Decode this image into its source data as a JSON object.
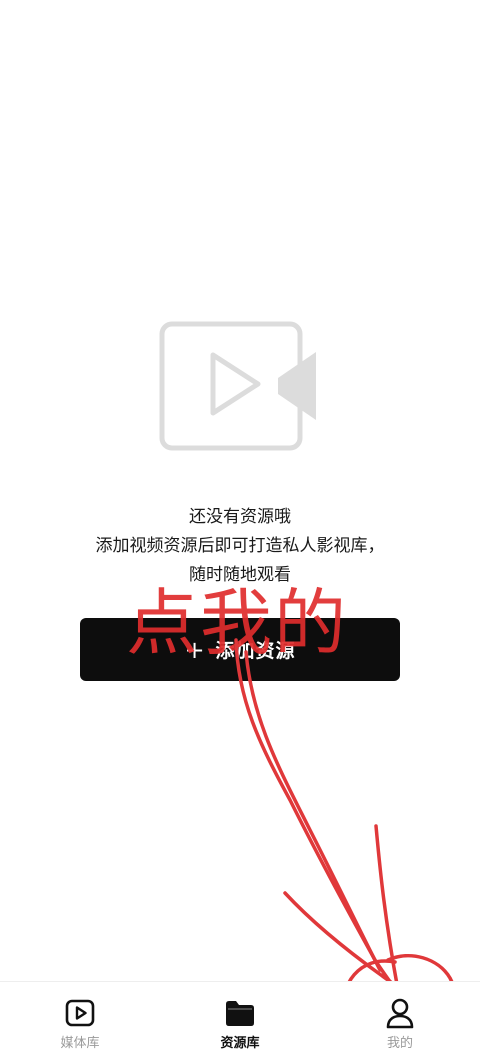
{
  "empty_state": {
    "title": "还没有资源哦",
    "description_line1": "添加视频资源后即可打造私人影视库，",
    "description_line2": "随时随地观看",
    "illustration_icon": "video-camera-icon"
  },
  "add_button": {
    "plus": "+",
    "label": "添加资源"
  },
  "annotation": {
    "text": "点我的",
    "color": "#e02d2d"
  },
  "tabbar": {
    "tabs": [
      {
        "label": "媒体库",
        "icon": "play-square-icon",
        "active": false
      },
      {
        "label": "资源库",
        "icon": "folder-icon",
        "active": true
      },
      {
        "label": "我的",
        "icon": "person-icon",
        "active": false
      }
    ]
  }
}
